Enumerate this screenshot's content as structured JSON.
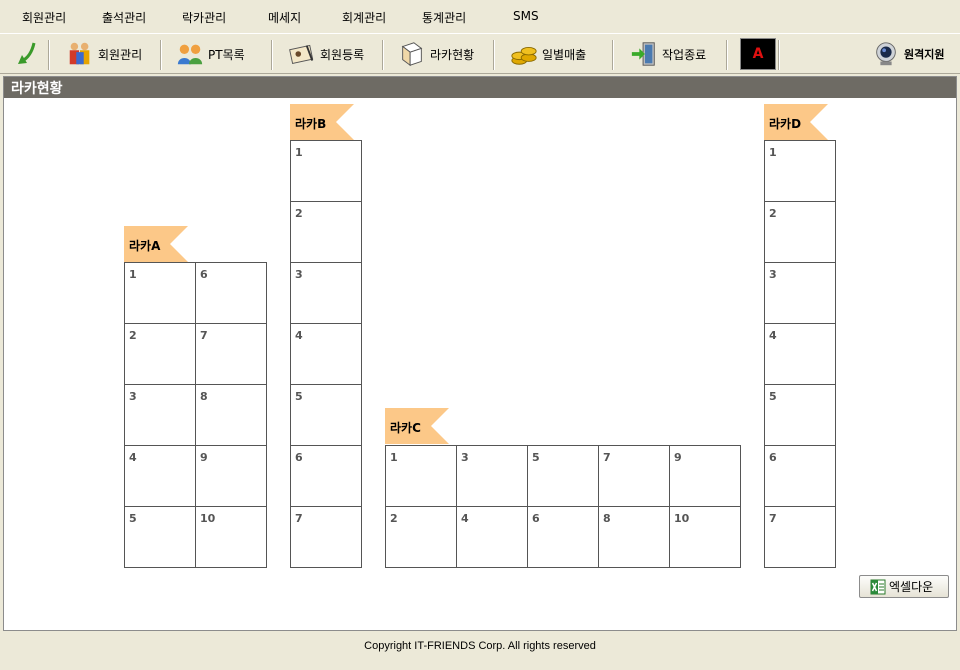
{
  "menu": [
    "회원관리",
    "출석관리",
    "락카관리",
    "메세지",
    "회계관리",
    "통계관리",
    "SMS"
  ],
  "toolbar": {
    "members_label": "회원관리",
    "pt_label": "PT목록",
    "register_label": "회원등록",
    "locker_label": "라카현황",
    "daily_sales_label": "일별매출",
    "exit_label": "작업종료",
    "remote_label": "원격지원",
    "a_badge": "A"
  },
  "panel": {
    "title": "라카현황",
    "excel_label": "엑셀다운"
  },
  "lockers": {
    "A": {
      "name": "라카A",
      "cells": [
        "1",
        "6",
        "2",
        "7",
        "3",
        "8",
        "4",
        "9",
        "5",
        "10"
      ]
    },
    "B": {
      "name": "라카B",
      "cells": [
        "1",
        "2",
        "3",
        "4",
        "5",
        "6",
        "7"
      ]
    },
    "C": {
      "name": "라카C",
      "cells": [
        "1",
        "3",
        "5",
        "7",
        "9",
        "2",
        "4",
        "6",
        "8",
        "10"
      ]
    },
    "D": {
      "name": "라카D",
      "cells": [
        "1",
        "2",
        "3",
        "4",
        "5",
        "6",
        "7"
      ]
    }
  },
  "footer": "Copyright IT-FRIENDS Corp.  All rights reserved",
  "colors": {
    "tag": "#fcc888",
    "header": "#6e6b64",
    "chrome": "#ece9d8"
  }
}
